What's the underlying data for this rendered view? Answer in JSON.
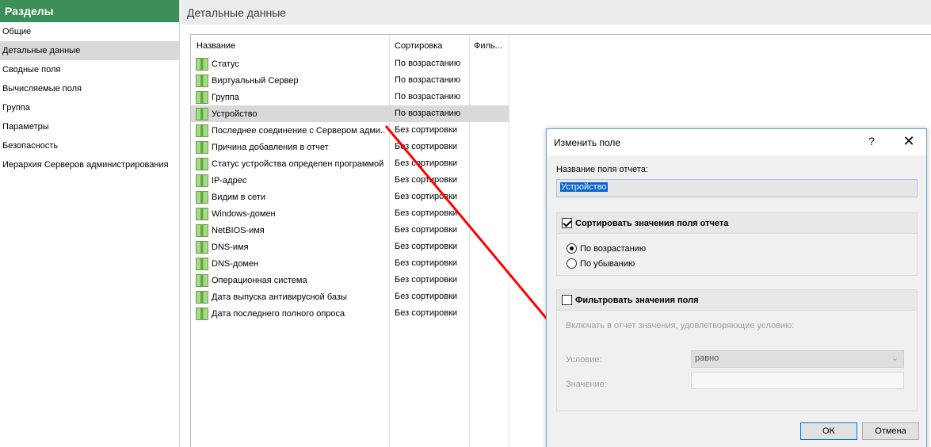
{
  "sidebar": {
    "title": "Разделы",
    "items": [
      {
        "label": "Общие"
      },
      {
        "label": "Детальные данные"
      },
      {
        "label": "Сводные поля"
      },
      {
        "label": "Вычисляемые поля"
      },
      {
        "label": "Группа"
      },
      {
        "label": "Параметры"
      },
      {
        "label": "Безопасность"
      },
      {
        "label": "Иерархия Серверов администрирования"
      }
    ],
    "active_index": 1
  },
  "main": {
    "title": "Детальные данные",
    "columns": [
      "Название",
      "Сортировка",
      "Филь..."
    ],
    "rows": [
      {
        "name": "Статус",
        "sort": "По возрастанию"
      },
      {
        "name": "Виртуальный Сервер",
        "sort": "По возрастанию"
      },
      {
        "name": "Группа",
        "sort": "По возрастанию"
      },
      {
        "name": "Устройство",
        "sort": "По возрастанию"
      },
      {
        "name": "Последнее соединение с Сервером адми...",
        "sort": "Без сортировки"
      },
      {
        "name": "Причина добавления в отчет",
        "sort": "Без сортировки"
      },
      {
        "name": "Статус устройства определен программой",
        "sort": "Без сортировки"
      },
      {
        "name": "IP-адрес",
        "sort": "Без сортировки"
      },
      {
        "name": "Видим в сети",
        "sort": "Без сортировки"
      },
      {
        "name": "Windows-домен",
        "sort": "Без сортировки"
      },
      {
        "name": "NetBIOS-имя",
        "sort": "Без сортировки"
      },
      {
        "name": "DNS-имя",
        "sort": "Без сортировки"
      },
      {
        "name": "DNS-домен",
        "sort": "Без сортировки"
      },
      {
        "name": "Операционная система",
        "sort": "Без сортировки"
      },
      {
        "name": "Дата выпуска антивирусной базы",
        "sort": "Без сортировки"
      },
      {
        "name": "Дата последнего полного опроса",
        "sort": "Без сортировки"
      }
    ],
    "selected_index": 3,
    "row_icon": "field-icon"
  },
  "dialog": {
    "title": "Изменить поле",
    "help_label": "?",
    "close_label": "✕",
    "field_name_label": "Название поля отчета:",
    "field_name_value": "Устройство",
    "sort_group": {
      "label": "Сортировать значения поля отчета",
      "checked": true,
      "asc_label": "По возрастанию",
      "desc_label": "По убыванию",
      "selected": "asc"
    },
    "filter_group": {
      "label": "Фильтровать значения поля",
      "checked": false,
      "hint": "Включать в отчет значения, удовлетворяющие условию:",
      "condition_label": "Условие:",
      "condition_value": "равно",
      "value_label": "Значение:",
      "value_value": ""
    },
    "ok_label": "OK",
    "cancel_label": "Отмена"
  },
  "colors": {
    "sidebar_header": "#3b8f57",
    "selection": "#d9d9d9",
    "arrow": "#ff0000",
    "dialog_border": "#6d9fd6"
  }
}
